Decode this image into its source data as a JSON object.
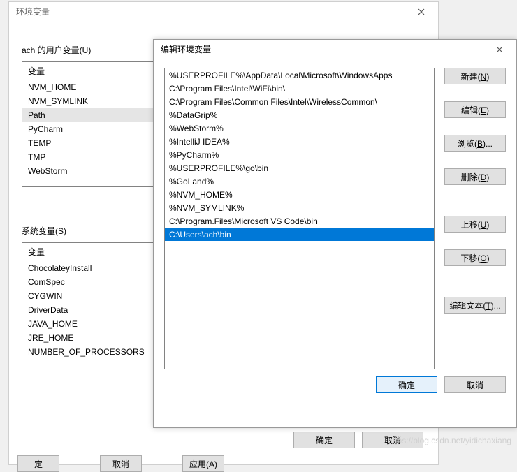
{
  "backDialog": {
    "title": "环境变量",
    "userSection": {
      "label": "ach 的用户变量(U)",
      "header": "变量"
    },
    "userVars": [
      "NVM_HOME",
      "NVM_SYMLINK",
      "Path",
      "PyCharm",
      "TEMP",
      "TMP",
      "WebStorm"
    ],
    "userSelected": "Path",
    "sysSection": {
      "label": "系统变量(S)",
      "header": "变量"
    },
    "sysVars": [
      "ChocolateyInstall",
      "ComSpec",
      "CYGWIN",
      "DriverData",
      "JAVA_HOME",
      "JRE_HOME",
      "NUMBER_OF_PROCESSORS"
    ],
    "ok": "确定",
    "cancel": "取消"
  },
  "frontDialog": {
    "title": "编辑环境变量",
    "paths": [
      "%USERPROFILE%\\AppData\\Local\\Microsoft\\WindowsApps",
      "C:\\Program Files\\Intel\\WiFi\\bin\\",
      "C:\\Program Files\\Common Files\\Intel\\WirelessCommon\\",
      "%DataGrip%",
      "%WebStorm%",
      "%IntelliJ IDEA%",
      "%PyCharm%",
      "%USERPROFILE%\\go\\bin",
      "%GoLand%",
      "%NVM_HOME%",
      "%NVM_SYMLINK%",
      "C:\\Program.Files\\Microsoft VS Code\\bin",
      "C:\\Users\\ach\\bin"
    ],
    "selectedIndex": 12,
    "buttons": {
      "new": {
        "text": "新建(",
        "key": "N",
        "suffix": ")"
      },
      "edit": {
        "text": "编辑(",
        "key": "E",
        "suffix": ")"
      },
      "browse": {
        "text": "浏览(",
        "key": "B",
        "suffix": ")..."
      },
      "delete": {
        "text": "删除(",
        "key": "D",
        "suffix": ")"
      },
      "up": {
        "text": "上移(",
        "key": "U",
        "suffix": ")"
      },
      "down": {
        "text": "下移(",
        "key": "O",
        "suffix": ")"
      },
      "text": {
        "text": "编辑文本(",
        "key": "T",
        "suffix": ")..."
      }
    },
    "ok": "确定",
    "cancel": "取消"
  },
  "stray": {
    "b1": "定",
    "b2": "取消",
    "b3": "应用(A)"
  },
  "watermark": "https://blog.csdn.net/yidichaxiang"
}
